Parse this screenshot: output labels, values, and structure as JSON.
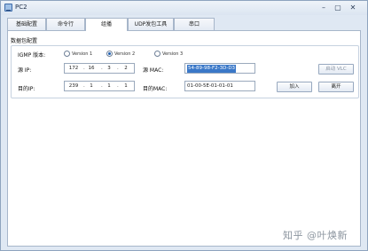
{
  "window": {
    "title": "PC2",
    "minimize": "–",
    "maximize": "▢",
    "close": "✕"
  },
  "tabs": [
    "基础配置",
    "命令行",
    "组播",
    "UDP发包工具",
    "串口"
  ],
  "group_title": "数据包配置",
  "igmp": {
    "label": "IGMP 版本:",
    "options": [
      "Version 1",
      "Version 2",
      "Version 3"
    ],
    "selected": "Version 2"
  },
  "source_ip": {
    "label": "源 IP:",
    "octets": [
      "172",
      "16",
      "3",
      "2"
    ]
  },
  "dest_ip": {
    "label": "目的IP:",
    "octets": [
      "239",
      "1",
      "1",
      "1"
    ]
  },
  "source_mac": {
    "label": "源  MAC:",
    "value": "54-89-98-F2-3D-D3"
  },
  "dest_mac": {
    "label": "目的MAC:",
    "value": "01-00-5E-01-01-01"
  },
  "buttons": {
    "vlan": "启动 VLC",
    "join": "加入",
    "leave": "离开"
  },
  "watermark": "知乎 @叶焕新"
}
